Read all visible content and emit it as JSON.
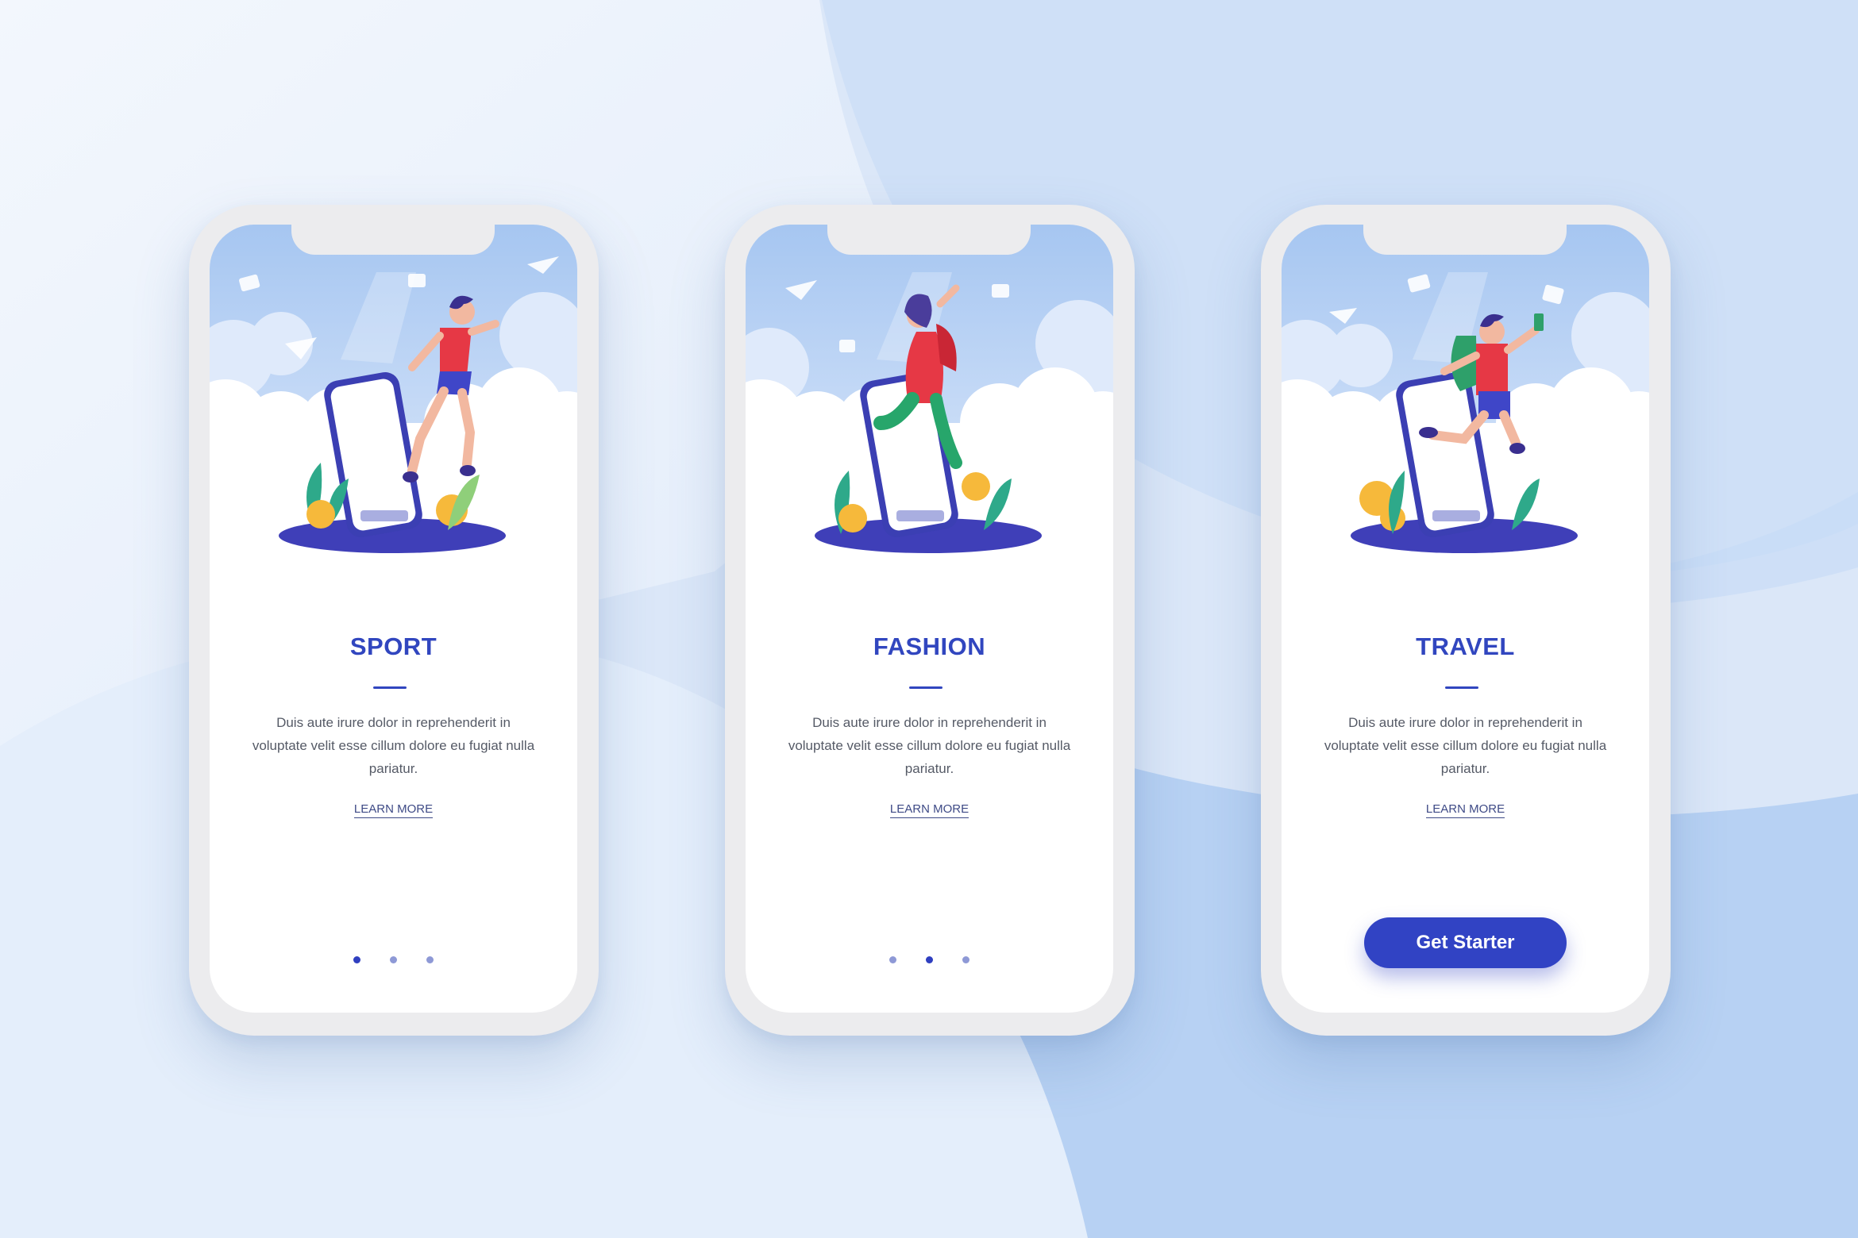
{
  "screens": [
    {
      "title": "SPORT",
      "description": "Duis aute irure dolor in reprehenderit in voluptate velit esse cillum dolore eu fugiat nulla pariatur.",
      "link": "LEARN MORE",
      "active_dot": 0,
      "illustration": "runner-illustration"
    },
    {
      "title": "FASHION",
      "description": "Duis aute irure dolor in reprehenderit in voluptate velit esse cillum dolore eu fugiat nulla pariatur.",
      "link": "LEARN MORE",
      "active_dot": 1,
      "illustration": "fashion-illustration"
    },
    {
      "title": "TRAVEL",
      "description": "Duis aute irure dolor in reprehenderit in voluptate velit esse cillum dolore eu fugiat nulla pariatur.",
      "link": "LEARN MORE",
      "button": "Get Starter",
      "illustration": "traveler-illustration"
    }
  ],
  "colors": {
    "accent": "#3146bf",
    "button": "#3143c4",
    "dot_active": "#2f3fc0",
    "dot_inactive": "#8e99d6",
    "sky": "#a9c8f1"
  }
}
